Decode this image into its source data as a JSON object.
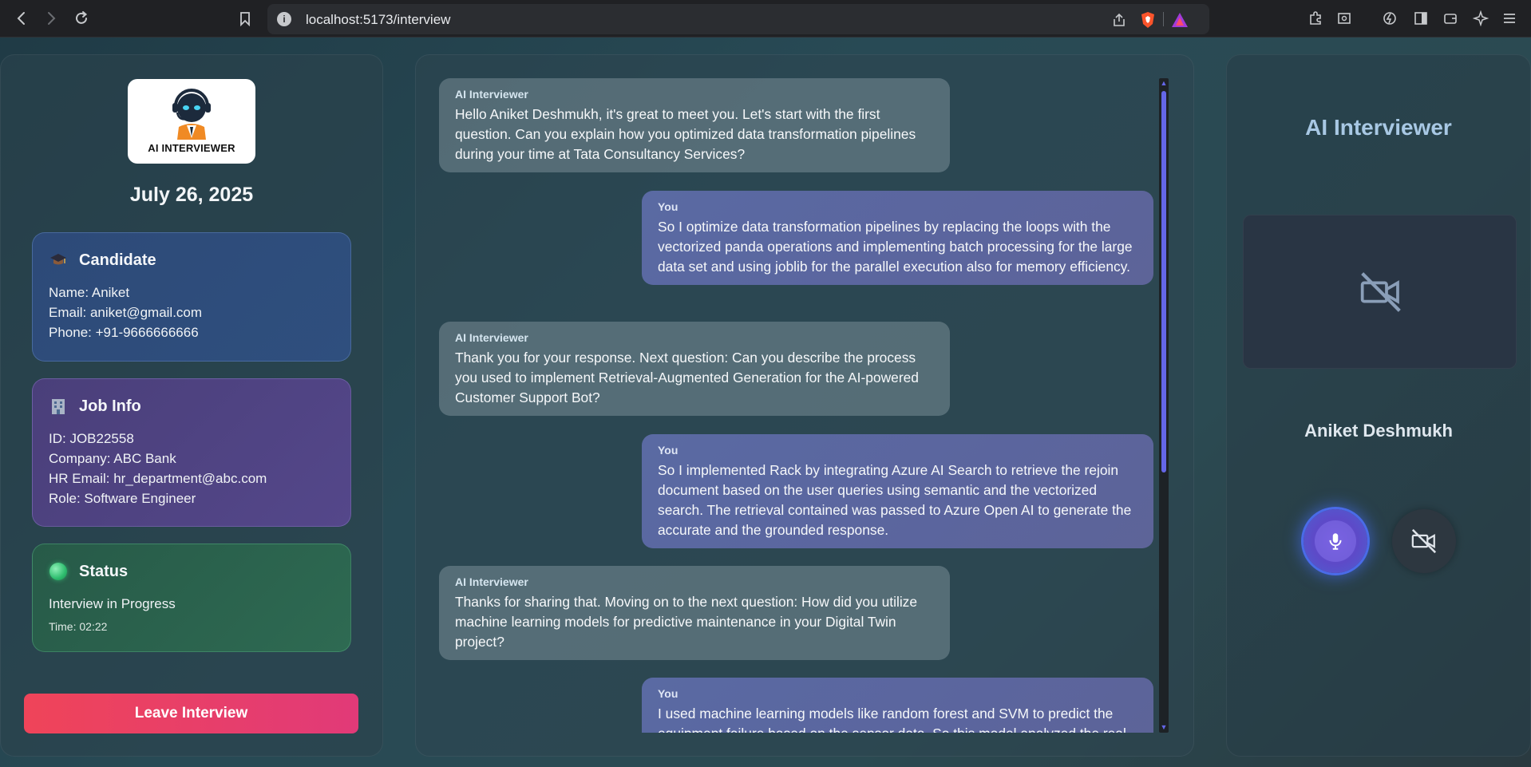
{
  "browser": {
    "url": "localhost:5173/interview",
    "icons": [
      "back-icon",
      "forward-icon",
      "reload-icon",
      "bookmark-icon",
      "site-info-icon",
      "share-icon",
      "brave-shield-icon",
      "brave-rewards-icon",
      "extensions-icon",
      "reader-icon",
      "leo-icon",
      "sidebar-icon",
      "wallet-icon",
      "ai-icon",
      "menu-icon"
    ]
  },
  "sidebar": {
    "logo_text": "AI INTERVIEWER",
    "date": "July 26, 2025",
    "candidate": {
      "title": "Candidate",
      "icon": "graduation-cap-icon",
      "name": "Name: Aniket",
      "email": "Email: aniket@gmail.com",
      "phone": "Phone: +91-9666666666"
    },
    "job": {
      "title": "Job Info",
      "icon": "office-building-icon",
      "id": "ID: JOB22558",
      "company": "Company: ABC Bank",
      "hr_email": "HR Email: hr_department@abc.com",
      "role": "Role: Software Engineer"
    },
    "status": {
      "title": "Status",
      "icon": "green-circle-icon",
      "state": "Interview in Progress",
      "time": "Time: 02:22"
    },
    "leave_label": "Leave Interview"
  },
  "chat": {
    "messages": [
      {
        "sender": "AI Interviewer",
        "role": "ai",
        "text": "Hello Aniket Deshmukh, it's great to meet you. Let's start with the first question. Can you explain how you optimized data transformation pipelines during your time at Tata Consultancy Services?"
      },
      {
        "sender": "You",
        "role": "you",
        "text": "So I optimize data transformation pipelines by replacing the loops with the vectorized panda operations and implementing batch processing for the large data set and using joblib for the parallel execution also for memory efficiency."
      },
      {
        "sender": "AI Interviewer",
        "role": "ai",
        "text": "Thank you for your response. Next question: Can you describe the process you used to implement Retrieval-Augmented Generation for the AI-powered Customer Support Bot?"
      },
      {
        "sender": "You",
        "role": "you",
        "text": "So I implemented Rack by integrating Azure AI Search to retrieve the rejoin document based on the user queries using semantic and the vectorized search. The retrieval contained was passed to Azure Open AI to generate the accurate and the grounded response."
      },
      {
        "sender": "AI Interviewer",
        "role": "ai",
        "text": "Thanks for sharing that. Moving on to the next question: How did you utilize machine learning models for predictive maintenance in your Digital Twin project?"
      },
      {
        "sender": "You",
        "role": "you",
        "text": "I used machine learning models like random forest and SVM to predict the equipment failure based on the sensor data. So this model analyzed the real"
      }
    ]
  },
  "right": {
    "title": "AI Interviewer",
    "candidate_name": "Aniket Deshmukh",
    "video_state_icon": "camera-off-icon",
    "mic_icon": "microphone-icon",
    "camera_toggle_icon": "camera-off-icon"
  },
  "colors": {
    "accent": "#6466e8",
    "leave_start": "#ef4459",
    "leave_end": "#e13a78",
    "title_blue": "#a8c8e4"
  }
}
